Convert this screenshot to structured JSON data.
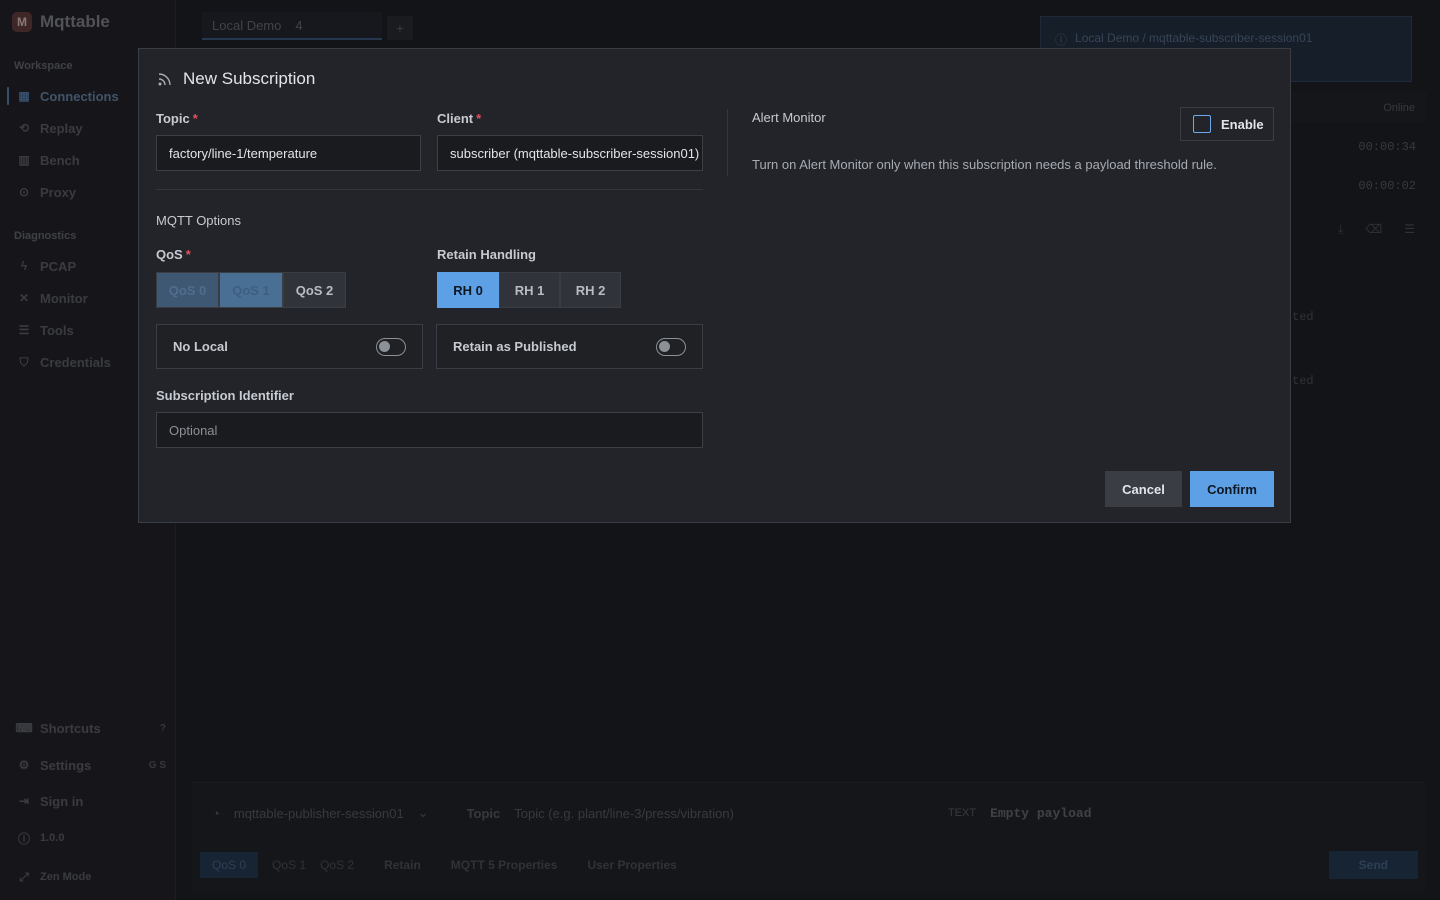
{
  "app": {
    "name": "Mqttable",
    "logo_letter": "M"
  },
  "sidebar": {
    "workspace_title": "Workspace",
    "diagnostics_title": "Diagnostics",
    "workspace_items": [
      {
        "label": "Connections",
        "icon": "connections-icon"
      },
      {
        "label": "Replay",
        "icon": "replay-icon"
      },
      {
        "label": "Bench",
        "icon": "bench-icon"
      },
      {
        "label": "Proxy",
        "icon": "proxy-icon"
      }
    ],
    "diagnostic_items": [
      {
        "label": "PCAP",
        "icon": "pcap-icon"
      },
      {
        "label": "Monitor",
        "icon": "monitor-icon"
      },
      {
        "label": "Tools",
        "icon": "tools-icon"
      },
      {
        "label": "Credentials",
        "icon": "shield-icon"
      }
    ],
    "bottom_items": [
      {
        "label": "Shortcuts",
        "kbd": "?"
      },
      {
        "label": "Settings",
        "kbd": "G S"
      },
      {
        "label": "Sign in",
        "kbd": ""
      },
      {
        "label": "1.0.0",
        "kbd": ""
      },
      {
        "label": "Zen Mode",
        "kbd": ""
      }
    ]
  },
  "background": {
    "tab_label": "Local Demo",
    "tab_count": "4",
    "add_tab": "+",
    "banner_text": "Local Demo / mqttable-subscriber-session01",
    "status": "Online",
    "times": [
      "00:00:34",
      "00:00:02"
    ],
    "ghost_text": [
      "ted",
      "ted"
    ],
    "composer": {
      "client": "mqttable-publisher-session01",
      "topic_label": "Topic",
      "topic_placeholder": "Topic (e.g. plant/line-3/press/vibration)",
      "format": "TEXT",
      "payload": "Empty payload",
      "qos": [
        "QoS 0",
        "QoS 1",
        "QoS 2"
      ],
      "retain": "Retain",
      "mqtt5": "MQTT 5 Properties",
      "user_props": "User Properties",
      "send": "Send"
    }
  },
  "modal": {
    "title": "New Subscription",
    "topic_label": "Topic",
    "topic_value": "factory/line-1/temperature",
    "client_label": "Client",
    "client_value": "subscriber (mqttable-subscriber-session01)",
    "required_mark": "*",
    "mqtt_options_title": "MQTT Options",
    "qos_label": "QoS",
    "qos_options": [
      "QoS 0",
      "QoS 1",
      "QoS 2"
    ],
    "retain_handling_label": "Retain Handling",
    "rh_options": [
      "RH 0",
      "RH 1",
      "RH 2"
    ],
    "no_local_label": "No Local",
    "retain_as_published_label": "Retain as Published",
    "sub_id_label": "Subscription Identifier",
    "sub_id_placeholder": "Optional",
    "alert_title": "Alert Monitor",
    "enable_label": "Enable",
    "alert_desc": "Turn on Alert Monitor only when this subscription needs a payload threshold rule.",
    "cancel": "Cancel",
    "confirm": "Confirm"
  },
  "colors": {
    "accent": "#5da0e6",
    "required": "#e0525c",
    "modal_bg": "#22242a"
  }
}
